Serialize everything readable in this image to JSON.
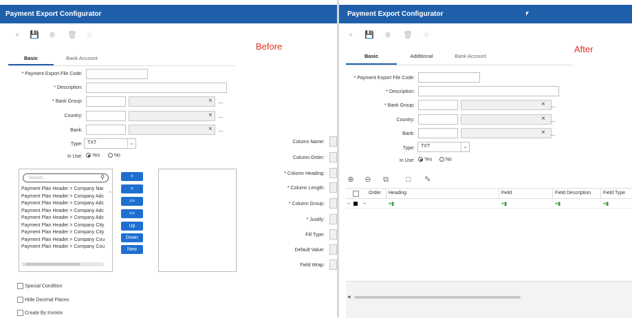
{
  "left": {
    "title": "Payment Export Configurator",
    "annotation": "Before",
    "tabs": [
      "Basic",
      "Bank Account"
    ],
    "form": {
      "file_code_label": "* Payment Export File Code:",
      "description_label": "* Description:",
      "bank_group_label": "* Bank Group:",
      "country_label": "Country:",
      "bank_label": "Bank:",
      "type_label": "Type:",
      "type_value": "TXT",
      "in_use_label": "In Use:",
      "yes": "Yes",
      "no": "No"
    },
    "search_placeholder": "Search...",
    "list_items": [
      "Payment Plan Header > Company Nar",
      "Payment Plan Header > Company Adc",
      "Payment Plan Header > Company Adc",
      "Payment Plan Header > Company Adc",
      "Payment Plan Header > Company Adc",
      "Payment Plan Header > Company City",
      "Payment Plan Header > Company City",
      "Payment Plan Header > Company Cou",
      "Payment Plan Header > Company Cou"
    ],
    "buttons": [
      ">",
      "<",
      ">>",
      "<<",
      "Up",
      "Down",
      "New"
    ],
    "column_labels": [
      "Column Name:",
      "Column Order:",
      "* Column Heading:",
      "* Column Length:",
      "* Column Group:",
      "* Justify:",
      "Fill Type:",
      "Default Value:",
      "Field Wrap:"
    ],
    "checkboxes": [
      "Special Condition",
      "Hide Decimal Places",
      "Create By Invoice"
    ]
  },
  "right": {
    "title": "Payment Export Configurator",
    "annotation": "After",
    "tabs": [
      "Basic",
      "Additional",
      "Bank Account"
    ],
    "form": {
      "file_code_label": "* Payment Export File Code:",
      "description_label": "* Description:",
      "bank_group_label": "* Bank Group:",
      "country_label": "Country:",
      "bank_label": "Bank:",
      "type_label": "Type:",
      "type_value": "TXT",
      "in_use_label": "In Use:",
      "yes": "Yes",
      "no": "No"
    },
    "grid_headers": [
      "Order",
      "Heading",
      "Field",
      "Field Description",
      "Field Type"
    ],
    "row_marker": "–"
  },
  "colors": {
    "titlebar": "#1f5faa",
    "button": "#1f6fd0",
    "annotation": "#e0301e"
  },
  "icons": [
    "plus-icon",
    "save-icon",
    "cancel-icon",
    "delete-icon",
    "star-icon"
  ]
}
